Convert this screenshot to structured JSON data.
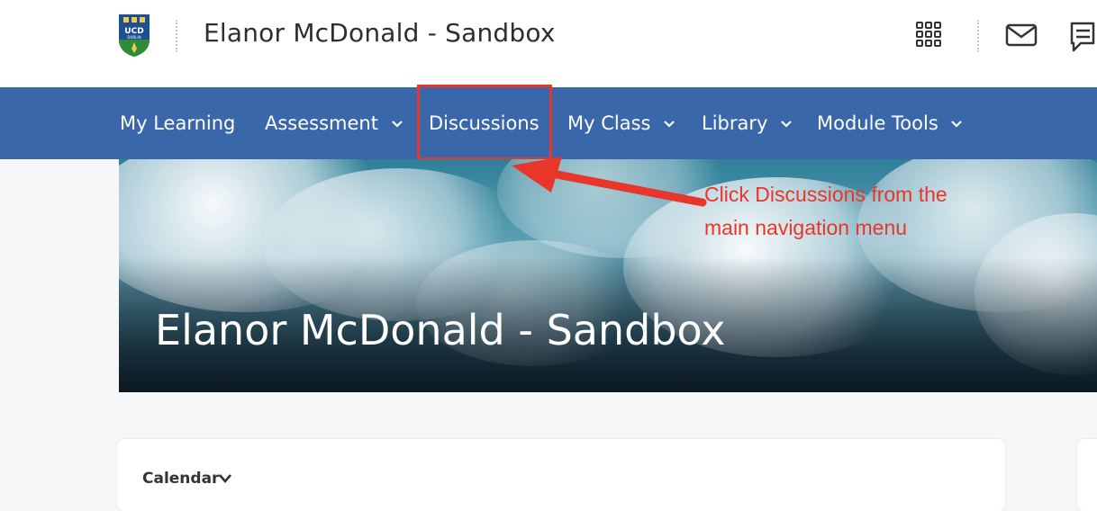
{
  "header": {
    "course_title": "Elanor McDonald - Sandbox",
    "logo_text": "UCD",
    "logo_subtext": "DUBLIN",
    "icons": [
      "grid-icon",
      "mail-icon",
      "chat-icon"
    ]
  },
  "nav": {
    "items": [
      {
        "label": "My Learning",
        "has_dropdown": false
      },
      {
        "label": "Assessment",
        "has_dropdown": true
      },
      {
        "label": "Discussions",
        "has_dropdown": false,
        "highlighted": true
      },
      {
        "label": "My Class",
        "has_dropdown": true
      },
      {
        "label": "Library",
        "has_dropdown": true
      },
      {
        "label": "Module Tools",
        "has_dropdown": true
      }
    ]
  },
  "banner": {
    "title": "Elanor McDonald - Sandbox"
  },
  "annotation": {
    "line1": "Click Discussions from the",
    "line2": "main navigation menu",
    "color": "#e8362a"
  },
  "widgets": {
    "calendar_title": "Calendar"
  },
  "colors": {
    "nav_bg": "#3a67a9",
    "highlight": "#e8362a",
    "page_bg": "#f6f7f8"
  }
}
